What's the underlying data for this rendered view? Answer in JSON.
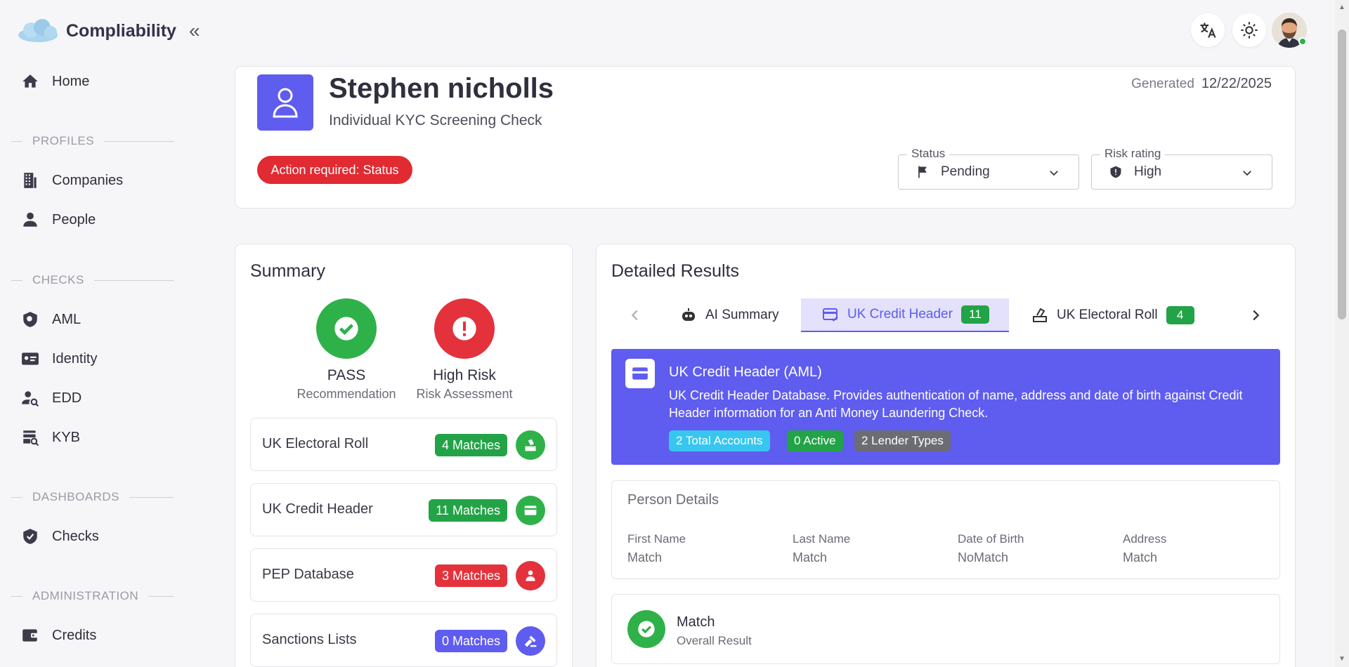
{
  "app": {
    "name": "Compliability"
  },
  "sidebar": {
    "home": "Home",
    "sections": {
      "profiles": "PROFILES",
      "checks": "CHECKS",
      "dashboards": "DASHBOARDS",
      "administration": "ADMINISTRATION"
    },
    "items": {
      "companies": "Companies",
      "people": "People",
      "aml": "AML",
      "identity": "Identity",
      "edd": "EDD",
      "kyb": "KYB",
      "checks": "Checks",
      "credits": "Credits"
    }
  },
  "header": {
    "name": "Stephen nicholls",
    "check_type": "Individual KYC Screening Check",
    "generated_label": "Generated",
    "generated_date": "12/22/2025",
    "action_pill": "Action required: Status",
    "status": {
      "label": "Status",
      "value": "Pending"
    },
    "risk": {
      "label": "Risk rating",
      "value": "High"
    }
  },
  "summary": {
    "title": "Summary",
    "recommendation": {
      "value": "PASS",
      "label": "Recommendation"
    },
    "risk_assessment": {
      "value": "High Risk",
      "label": "Risk Assessment"
    },
    "rows": [
      {
        "name": "UK Electoral Roll",
        "badge": "4 Matches"
      },
      {
        "name": "UK Credit Header",
        "badge": "11 Matches"
      },
      {
        "name": "PEP Database",
        "badge": "3 Matches"
      },
      {
        "name": "Sanctions Lists",
        "badge": "0 Matches"
      }
    ]
  },
  "detail": {
    "title": "Detailed Results",
    "tabs": [
      {
        "label": "AI Summary"
      },
      {
        "label": "UK Credit Header",
        "count": "11"
      },
      {
        "label": "UK Electoral Roll",
        "count": "4"
      }
    ],
    "panel": {
      "title": "UK Credit Header (AML)",
      "description": "UK Credit Header Database. Provides authentication of name, address and date of birth against Credit Header information for an Anti Money Laundering Check.",
      "tags": [
        "2 Total Accounts",
        "0 Active",
        "2 Lender Types"
      ]
    },
    "person_details": {
      "title": "Person Details",
      "fields": [
        {
          "key": "First Name",
          "value": "Match"
        },
        {
          "key": "Last Name",
          "value": "Match"
        },
        {
          "key": "Date of Birth",
          "value": "NoMatch"
        },
        {
          "key": "Address",
          "value": "Match"
        }
      ]
    },
    "overall": {
      "title": "Match",
      "subtitle": "Overall Result"
    }
  }
}
